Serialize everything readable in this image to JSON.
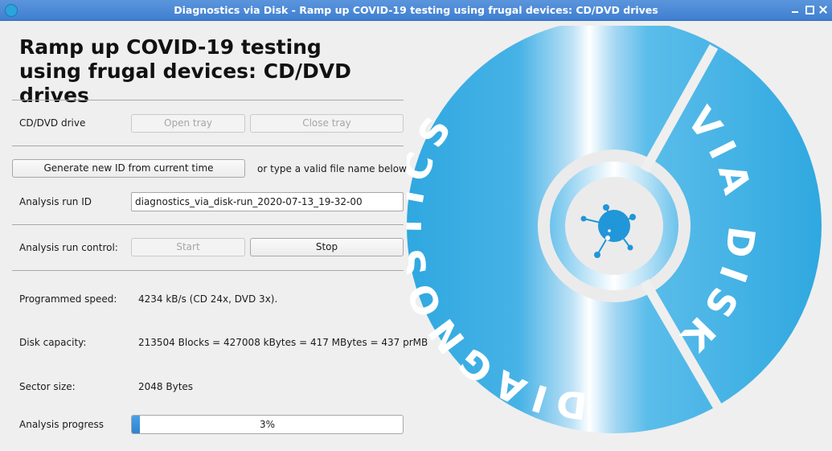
{
  "window": {
    "title": "Diagnostics via Disk - Ramp up COVID-19 testing using frugal devices: CD/DVD drives",
    "app_icon": "disc-icon",
    "controls": [
      "minimize-icon",
      "maximize-icon",
      "close-icon"
    ]
  },
  "header": {
    "title_line1": "Ramp up COVID-19 testing",
    "title_line2": "using frugal devices: CD/DVD drives"
  },
  "drive": {
    "label": "CD/DVD drive",
    "open_tray": "Open tray",
    "close_tray": "Close tray",
    "open_enabled": false,
    "close_enabled": false
  },
  "id_row": {
    "generate_button": "Generate new ID from current time",
    "hint": "or type a valid file name below"
  },
  "run_id": {
    "label": "Analysis run ID",
    "value": "diagnostics_via_disk-run_2020-07-13_19-32-00"
  },
  "control": {
    "label": "Analysis run control:",
    "start": "Start",
    "stop": "Stop",
    "start_enabled": false,
    "stop_enabled": true
  },
  "info": {
    "speed_label": "Programmed speed:",
    "speed_value": "4234 kB/s (CD  24x, DVD  3x).",
    "capacity_label": "Disk capacity:",
    "capacity_value": "213504 Blocks = 427008 kBytes = 417 MBytes = 437 prMB",
    "sector_label": "Sector size:",
    "sector_value": "2048 Bytes"
  },
  "progress": {
    "label": "Analysis progress",
    "text": "3%",
    "fraction": 0.03
  },
  "logo": {
    "text_left": "DIAGNOSTICS",
    "text_right": "VIA DISK",
    "primary_color": "#2fa8e0",
    "light_color": "#ffffff",
    "icon": "virus-icon"
  }
}
